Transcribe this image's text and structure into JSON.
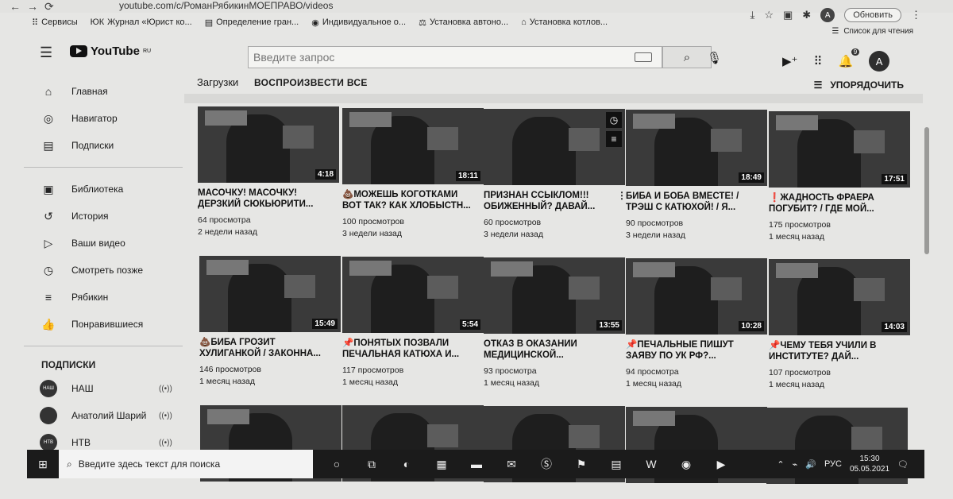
{
  "browser": {
    "url": "youtube.com/c/РоманРябикинМОЕПРАВО/videos",
    "update_label": "Обновить",
    "avatar_letter": "A",
    "bookmarks": [
      "Сервисы",
      "Журнал «Юрист ко...",
      "Определение гран...",
      "Индивидуальное о...",
      "Установка автоно...",
      "Установка котлов..."
    ],
    "bookmark_prefix": "ЮК",
    "reading_list": "Список для чтения"
  },
  "header": {
    "logo": "YouTube",
    "logo_region": "RU",
    "search_placeholder": "Введите запрос",
    "avatar_letter": "A",
    "notif_count": "9"
  },
  "sidebar": {
    "items": [
      {
        "label": "Главная",
        "icon": "home-icon"
      },
      {
        "label": "Навигатор",
        "icon": "compass-icon"
      },
      {
        "label": "Подписки",
        "icon": "subscriptions-icon"
      }
    ],
    "library": [
      {
        "label": "Библиотека",
        "icon": "library-icon"
      },
      {
        "label": "История",
        "icon": "history-icon"
      },
      {
        "label": "Ваши видео",
        "icon": "your-videos-icon"
      },
      {
        "label": "Смотреть позже",
        "icon": "watch-later-icon"
      },
      {
        "label": "Рябикин",
        "icon": "playlist-icon"
      },
      {
        "label": "Понравившиеся",
        "icon": "like-icon"
      }
    ],
    "subs_heading": "ПОДПИСКИ",
    "subs": [
      {
        "name": "НАШ",
        "avatar": "НАШ"
      },
      {
        "name": "Анатолий Шарий",
        "avatar": ""
      },
      {
        "name": "НТВ",
        "avatar": "НТВ"
      }
    ]
  },
  "main": {
    "uploads_label": "Загрузки",
    "play_all": "ВОСПРОИЗВЕСТИ ВСЕ",
    "sort_label": "УПОРЯДОЧИТЬ",
    "videos": [
      {
        "title": "МАСОЧКУ! МАСОЧКУ! ДЕРЗКИЙ СЮКЬЮРИТИ...",
        "views": "64 просмотра",
        "age": "2 недели назад",
        "duration": "4:18"
      },
      {
        "title": "💩МОЖЕШЬ КОГОТКАМИ ВОТ ТАК? КАК ХЛОБЫСТН...",
        "views": "100 просмотров",
        "age": "3 недели назад",
        "duration": "18:11"
      },
      {
        "title": "ПРИЗНАН ССЫКЛОМ!!! ОБИЖЕННЫЙ? ДАВАЙ...",
        "views": "60 просмотров",
        "age": "3 недели назад",
        "duration": ""
      },
      {
        "title": "БИБА И БОБА ВМЕСТЕ! / ТРЭШ С КАТЮХОЙ! / Я...",
        "views": "90 просмотров",
        "age": "3 недели назад",
        "duration": "18:49"
      },
      {
        "title": "❗ЖАДНОСТЬ ФРАЕРА ПОГУБИТ? / ГДЕ МОЙ...",
        "views": "175 просмотров",
        "age": "1 месяц назад",
        "duration": "17:51"
      },
      {
        "title": "💩БИБА ГРОЗИТ ХУЛИГАНКОЙ / ЗАКОННА...",
        "views": "146 просмотров",
        "age": "1 месяц назад",
        "duration": "15:49"
      },
      {
        "title": "📌ПОНЯТЫХ ПОЗВАЛИ ПЕЧАЛЬНАЯ КАТЮХА И...",
        "views": "117 просмотров",
        "age": "1 месяц назад",
        "duration": "5:54"
      },
      {
        "title": "ОТКАЗ В ОКАЗАНИИ МЕДИЦИНСКОЙ...",
        "views": "93 просмотра",
        "age": "1 месяц назад",
        "duration": "13:55"
      },
      {
        "title": "📌ПЕЧАЛЬНЫЕ ПИШУТ ЗАЯВУ ПО УК РФ?...",
        "views": "94 просмотра",
        "age": "1 месяц назад",
        "duration": "10:28"
      },
      {
        "title": "📌ЧЕМУ ТЕБЯ УЧИЛИ В ИНСТИТУТЕ? ДАЙ...",
        "views": "107 просмотров",
        "age": "1 месяц назад",
        "duration": "14:03"
      }
    ]
  },
  "taskbar": {
    "search_placeholder": "Введите здесь текст для поиска",
    "lang": "РУС",
    "time": "15:30",
    "date": "05.05.2021"
  }
}
